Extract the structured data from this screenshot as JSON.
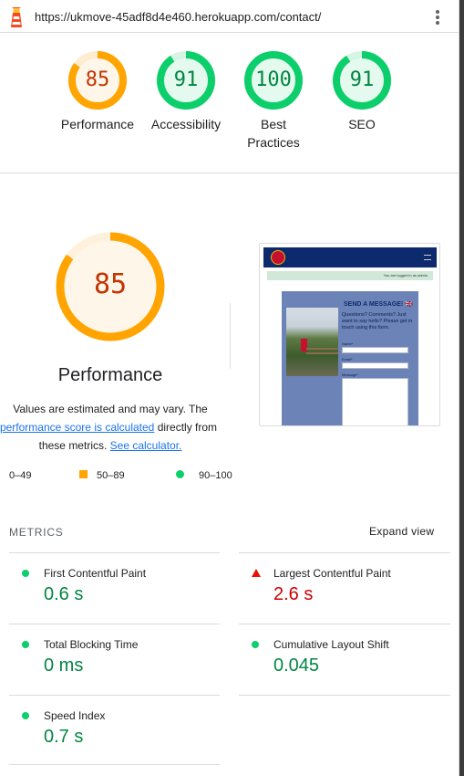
{
  "url_bar": {
    "url": "https://ukmove-45adf8d4e460.herokuapp.com/contact/",
    "logo_icon": "lighthouse-icon",
    "menu_icon": "kebab-menu-icon"
  },
  "colors": {
    "pass": "#0cce6b",
    "pass_text": "#018642",
    "average": "#ffa400",
    "average_text": "#c33300",
    "fail": "#ff4e42",
    "fail_text": "#cc0000",
    "link": "#1a73e8"
  },
  "gauges": [
    {
      "label": "Performance",
      "score": "85",
      "fraction": 0.85,
      "rating": "average"
    },
    {
      "label": "Accessibility",
      "score": "91",
      "fraction": 0.91,
      "rating": "pass"
    },
    {
      "label": "Best Practices",
      "score": "100",
      "fraction": 1.0,
      "rating": "pass"
    },
    {
      "label": "SEO",
      "score": "91",
      "fraction": 0.91,
      "rating": "pass"
    }
  ],
  "performance": {
    "score": "85",
    "fraction": 0.85,
    "title": "Performance",
    "desc_prefix": "Values are estimated and may vary. The ",
    "desc_link": "performance score is calculated",
    "desc_mid": " directly from these metrics. ",
    "desc_link2": "See calculator."
  },
  "legend": {
    "fail": "0–49",
    "average": "50–89",
    "pass": "90–100"
  },
  "screenshot": {
    "banner_text": "You are logged in as admin",
    "heading": "SEND A MESSAGE! 🇬🇧",
    "body_text": "Questions? Comments? Just want to say hello? Please get in touch using this form.",
    "field_name": "Name*",
    "field_email": "Email*",
    "field_message": "Message*"
  },
  "metrics": {
    "title": "METRICS",
    "expand_label": "Expand view",
    "items": [
      {
        "label": "First Contentful Paint",
        "value": "0.6 s",
        "rating": "pass"
      },
      {
        "label": "Largest Contentful Paint",
        "value": "2.6 s",
        "rating": "fail"
      },
      {
        "label": "Total Blocking Time",
        "value": "0 ms",
        "rating": "pass"
      },
      {
        "label": "Cumulative Layout Shift",
        "value": "0.045",
        "rating": "pass"
      },
      {
        "label": "Speed Index",
        "value": "0.7 s",
        "rating": "pass"
      }
    ]
  }
}
